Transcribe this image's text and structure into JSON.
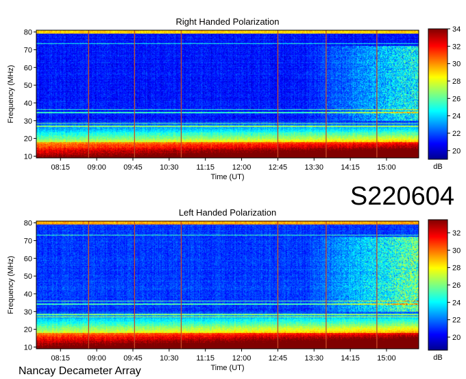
{
  "figure": {
    "station_label": "S220604",
    "observatory_label": "Nancay Decameter Array"
  },
  "chart_data": [
    {
      "type": "heatmap",
      "title": "Right Handed Polarization",
      "xlabel": "Time (UT)",
      "ylabel": "Frequency (MHz)",
      "x_ticks": [
        "08:15",
        "09:00",
        "09:45",
        "10:30",
        "11:15",
        "12:00",
        "12:45",
        "13:30",
        "14:15",
        "15:00"
      ],
      "x_range": [
        "07:45",
        "15:40"
      ],
      "y_ticks": [
        10,
        20,
        30,
        40,
        50,
        60,
        70,
        80
      ],
      "ylim": [
        9,
        81
      ],
      "colorbar": {
        "label": "dB",
        "ticks": [
          20,
          22,
          24,
          26,
          28,
          30,
          32,
          34
        ],
        "range": [
          19,
          34
        ],
        "colormap": "jet"
      },
      "vertical_markers_ut": [
        "08:50",
        "09:47",
        "10:45",
        "12:45",
        "13:45",
        "14:48"
      ]
    },
    {
      "type": "heatmap",
      "title": "Left Handed Polarization",
      "xlabel": "Time (UT)",
      "ylabel": "Frequency (MHz)",
      "x_ticks": [
        "08:15",
        "09:00",
        "09:45",
        "10:30",
        "11:15",
        "12:00",
        "12:45",
        "13:30",
        "14:15",
        "15:00"
      ],
      "x_range": [
        "07:45",
        "15:40"
      ],
      "y_ticks": [
        10,
        20,
        30,
        40,
        50,
        60,
        70,
        80
      ],
      "ylim": [
        9,
        81
      ],
      "colorbar": {
        "label": "dB",
        "ticks": [
          20,
          22,
          24,
          26,
          28,
          30,
          32
        ],
        "range": [
          18.5,
          33.5
        ],
        "colormap": "jet"
      },
      "vertical_markers_ut": [
        "08:50",
        "09:47",
        "10:45",
        "12:45",
        "13:45",
        "14:48"
      ]
    }
  ]
}
